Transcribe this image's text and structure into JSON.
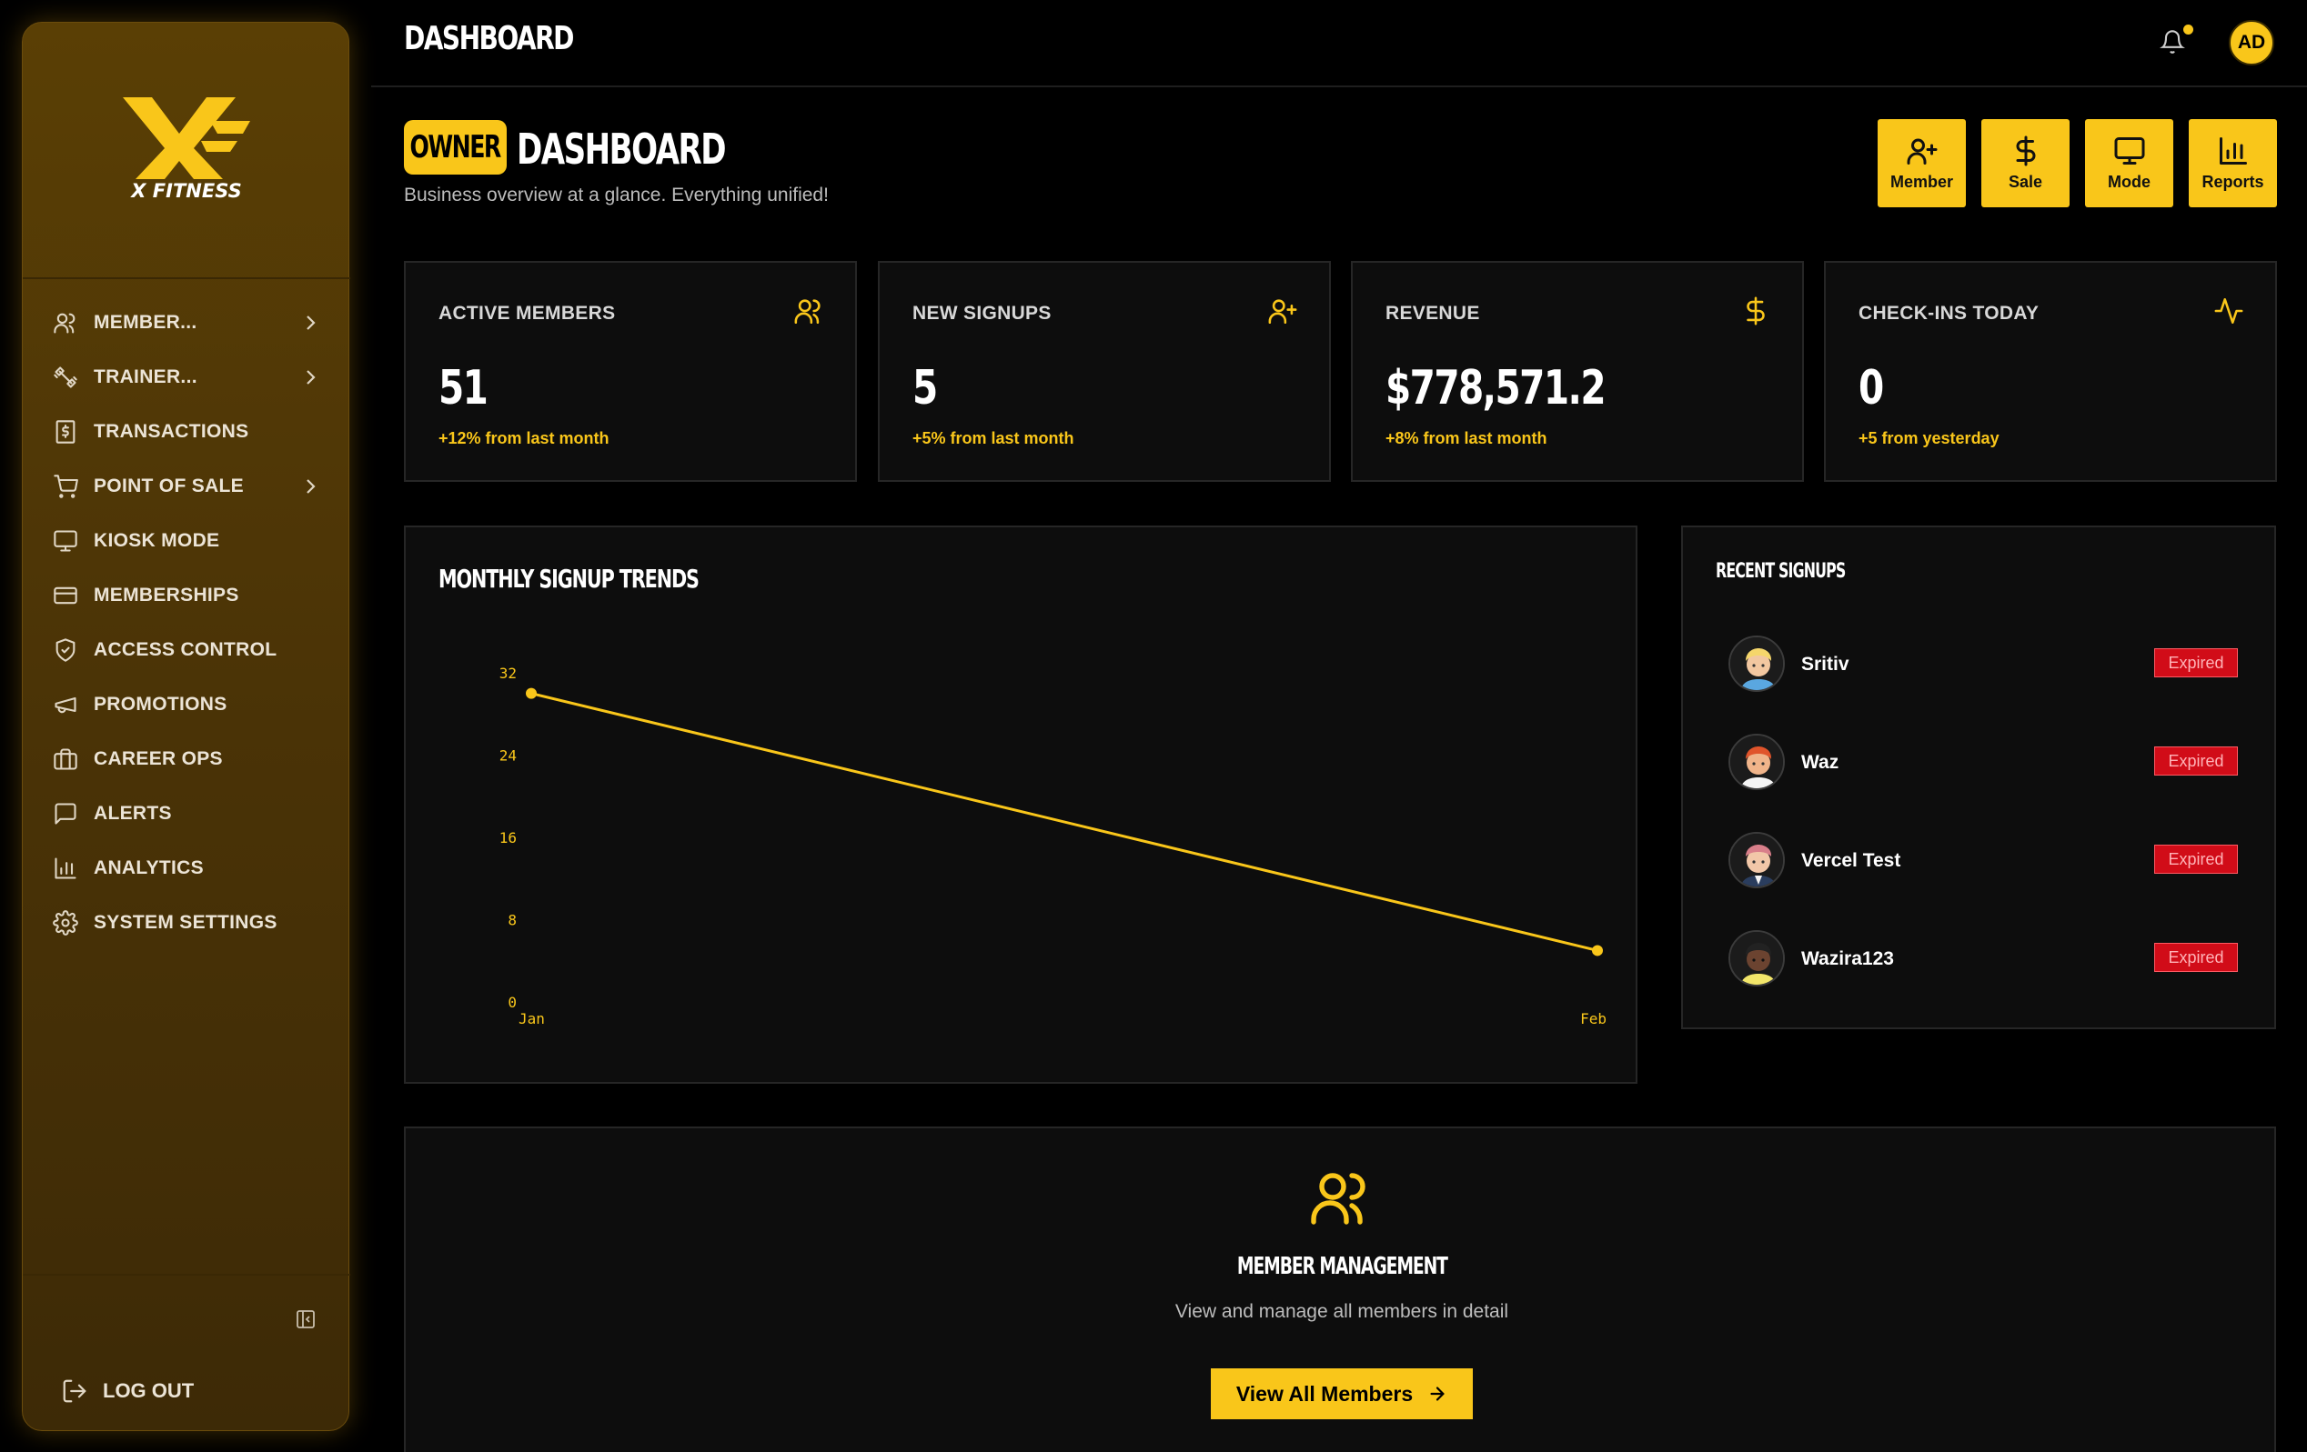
{
  "brand": {
    "name": "X FITNESS",
    "accent": "#f9c61a"
  },
  "topbar": {
    "title": "DASHBOARD",
    "user_initials": "AD"
  },
  "sidebar": {
    "items": [
      {
        "label": "MEMBER...",
        "icon": "users-icon",
        "has_submenu": true
      },
      {
        "label": "TRAINER...",
        "icon": "dumbbell-icon",
        "has_submenu": true
      },
      {
        "label": "TRANSACTIONS",
        "icon": "receipt-dollar-icon",
        "has_submenu": false
      },
      {
        "label": "POINT OF SALE",
        "icon": "cart-icon",
        "has_submenu": true
      },
      {
        "label": "KIOSK MODE",
        "icon": "monitor-icon",
        "has_submenu": false
      },
      {
        "label": "MEMBERSHIPS",
        "icon": "card-icon",
        "has_submenu": false
      },
      {
        "label": "ACCESS CONTROL",
        "icon": "shield-check-icon",
        "has_submenu": false
      },
      {
        "label": "PROMOTIONS",
        "icon": "megaphone-icon",
        "has_submenu": false
      },
      {
        "label": "CAREER OPS",
        "icon": "briefcase-icon",
        "has_submenu": false
      },
      {
        "label": "ALERTS",
        "icon": "message-icon",
        "has_submenu": false
      },
      {
        "label": "ANALYTICS",
        "icon": "bar-chart-icon",
        "has_submenu": false
      },
      {
        "label": "SYSTEM SETTINGS",
        "icon": "gear-icon",
        "has_submenu": false
      }
    ],
    "logout_label": "LOG OUT"
  },
  "header": {
    "badge": "OWNER",
    "title": "DASHBOARD",
    "subtitle": "Business overview at a glance. Everything unified!"
  },
  "quick_actions": [
    {
      "label": "Member",
      "icon": "user-plus-icon"
    },
    {
      "label": "Sale",
      "icon": "dollar-icon"
    },
    {
      "label": "Mode",
      "icon": "monitor-icon"
    },
    {
      "label": "Reports",
      "icon": "bar-chart-icon"
    }
  ],
  "stats": [
    {
      "label": "ACTIVE MEMBERS",
      "value": "51",
      "change": "+12% from last month",
      "icon": "users-icon"
    },
    {
      "label": "NEW SIGNUPS",
      "value": "5",
      "change": "+5% from last month",
      "icon": "user-plus-icon"
    },
    {
      "label": "REVENUE",
      "value": "$778,571.2",
      "change": "+8% from last month",
      "icon": "dollar-icon"
    },
    {
      "label": "CHECK-INS TODAY",
      "value": "0",
      "change": "+5 from yesterday",
      "icon": "activity-icon"
    }
  ],
  "chart_data": {
    "type": "line",
    "title": "MONTHLY SIGNUP TRENDS",
    "x": [
      "Jan",
      "Feb"
    ],
    "series": [
      {
        "values": [
          30,
          5
        ]
      }
    ],
    "ylim": [
      0,
      32
    ],
    "yticks": [
      0,
      8,
      16,
      24,
      32
    ],
    "grid": false,
    "color": "#f9c61a"
  },
  "recent_signups": {
    "title": "RECENT SIGNUPS",
    "items": [
      {
        "name": "Sritiv",
        "status": "Expired"
      },
      {
        "name": "Waz",
        "status": "Expired"
      },
      {
        "name": "Vercel Test",
        "status": "Expired"
      },
      {
        "name": "Wazira123",
        "status": "Expired"
      }
    ]
  },
  "member_management": {
    "title": "MEMBER MANAGEMENT",
    "subtitle": "View and manage all members in detail",
    "button_label": "View All Members"
  }
}
